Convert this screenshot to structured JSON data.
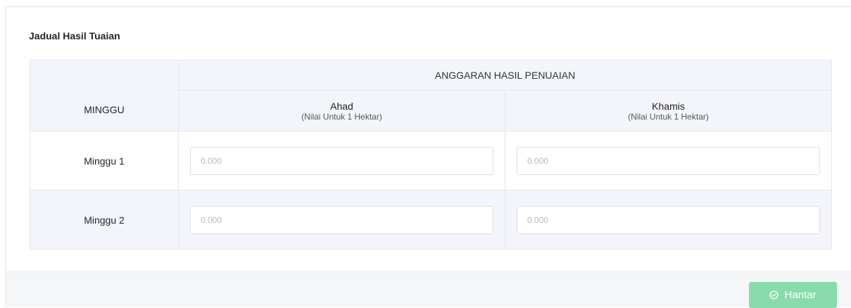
{
  "card": {
    "title": "Jadual Hasil Tuaian"
  },
  "table": {
    "group_header": "ANGGARAN HASIL PENUAIAN",
    "week_header": "MINGGU",
    "days": [
      {
        "name": "Ahad",
        "note": "(Nilai Untuk 1 Hektar)"
      },
      {
        "name": "Khamis",
        "note": "(Nilai Untuk 1 Hektar)"
      }
    ],
    "rows": [
      {
        "label": "Minggu 1",
        "values": [
          "",
          ""
        ],
        "placeholders": [
          "0.000",
          "0.000"
        ]
      },
      {
        "label": "Minggu 2",
        "values": [
          "",
          ""
        ],
        "placeholders": [
          "0.000",
          "0.000"
        ]
      }
    ]
  },
  "footer": {
    "submit_label": "Hantar",
    "submit_icon": "check-circle-icon",
    "submit_color": "#88dcac"
  }
}
